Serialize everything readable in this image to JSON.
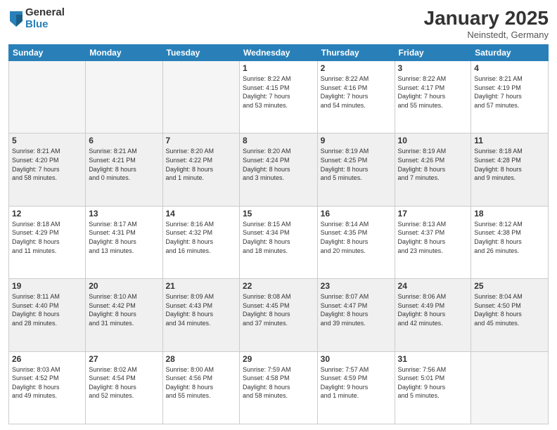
{
  "header": {
    "logo_general": "General",
    "logo_blue": "Blue",
    "month_title": "January 2025",
    "location": "Neinstedt, Germany"
  },
  "days_of_week": [
    "Sunday",
    "Monday",
    "Tuesday",
    "Wednesday",
    "Thursday",
    "Friday",
    "Saturday"
  ],
  "weeks": [
    {
      "shaded": false,
      "days": [
        {
          "num": "",
          "info": ""
        },
        {
          "num": "",
          "info": ""
        },
        {
          "num": "",
          "info": ""
        },
        {
          "num": "1",
          "info": "Sunrise: 8:22 AM\nSunset: 4:15 PM\nDaylight: 7 hours\nand 53 minutes."
        },
        {
          "num": "2",
          "info": "Sunrise: 8:22 AM\nSunset: 4:16 PM\nDaylight: 7 hours\nand 54 minutes."
        },
        {
          "num": "3",
          "info": "Sunrise: 8:22 AM\nSunset: 4:17 PM\nDaylight: 7 hours\nand 55 minutes."
        },
        {
          "num": "4",
          "info": "Sunrise: 8:21 AM\nSunset: 4:19 PM\nDaylight: 7 hours\nand 57 minutes."
        }
      ]
    },
    {
      "shaded": true,
      "days": [
        {
          "num": "5",
          "info": "Sunrise: 8:21 AM\nSunset: 4:20 PM\nDaylight: 7 hours\nand 58 minutes."
        },
        {
          "num": "6",
          "info": "Sunrise: 8:21 AM\nSunset: 4:21 PM\nDaylight: 8 hours\nand 0 minutes."
        },
        {
          "num": "7",
          "info": "Sunrise: 8:20 AM\nSunset: 4:22 PM\nDaylight: 8 hours\nand 1 minute."
        },
        {
          "num": "8",
          "info": "Sunrise: 8:20 AM\nSunset: 4:24 PM\nDaylight: 8 hours\nand 3 minutes."
        },
        {
          "num": "9",
          "info": "Sunrise: 8:19 AM\nSunset: 4:25 PM\nDaylight: 8 hours\nand 5 minutes."
        },
        {
          "num": "10",
          "info": "Sunrise: 8:19 AM\nSunset: 4:26 PM\nDaylight: 8 hours\nand 7 minutes."
        },
        {
          "num": "11",
          "info": "Sunrise: 8:18 AM\nSunset: 4:28 PM\nDaylight: 8 hours\nand 9 minutes."
        }
      ]
    },
    {
      "shaded": false,
      "days": [
        {
          "num": "12",
          "info": "Sunrise: 8:18 AM\nSunset: 4:29 PM\nDaylight: 8 hours\nand 11 minutes."
        },
        {
          "num": "13",
          "info": "Sunrise: 8:17 AM\nSunset: 4:31 PM\nDaylight: 8 hours\nand 13 minutes."
        },
        {
          "num": "14",
          "info": "Sunrise: 8:16 AM\nSunset: 4:32 PM\nDaylight: 8 hours\nand 16 minutes."
        },
        {
          "num": "15",
          "info": "Sunrise: 8:15 AM\nSunset: 4:34 PM\nDaylight: 8 hours\nand 18 minutes."
        },
        {
          "num": "16",
          "info": "Sunrise: 8:14 AM\nSunset: 4:35 PM\nDaylight: 8 hours\nand 20 minutes."
        },
        {
          "num": "17",
          "info": "Sunrise: 8:13 AM\nSunset: 4:37 PM\nDaylight: 8 hours\nand 23 minutes."
        },
        {
          "num": "18",
          "info": "Sunrise: 8:12 AM\nSunset: 4:38 PM\nDaylight: 8 hours\nand 26 minutes."
        }
      ]
    },
    {
      "shaded": true,
      "days": [
        {
          "num": "19",
          "info": "Sunrise: 8:11 AM\nSunset: 4:40 PM\nDaylight: 8 hours\nand 28 minutes."
        },
        {
          "num": "20",
          "info": "Sunrise: 8:10 AM\nSunset: 4:42 PM\nDaylight: 8 hours\nand 31 minutes."
        },
        {
          "num": "21",
          "info": "Sunrise: 8:09 AM\nSunset: 4:43 PM\nDaylight: 8 hours\nand 34 minutes."
        },
        {
          "num": "22",
          "info": "Sunrise: 8:08 AM\nSunset: 4:45 PM\nDaylight: 8 hours\nand 37 minutes."
        },
        {
          "num": "23",
          "info": "Sunrise: 8:07 AM\nSunset: 4:47 PM\nDaylight: 8 hours\nand 39 minutes."
        },
        {
          "num": "24",
          "info": "Sunrise: 8:06 AM\nSunset: 4:49 PM\nDaylight: 8 hours\nand 42 minutes."
        },
        {
          "num": "25",
          "info": "Sunrise: 8:04 AM\nSunset: 4:50 PM\nDaylight: 8 hours\nand 45 minutes."
        }
      ]
    },
    {
      "shaded": false,
      "days": [
        {
          "num": "26",
          "info": "Sunrise: 8:03 AM\nSunset: 4:52 PM\nDaylight: 8 hours\nand 49 minutes."
        },
        {
          "num": "27",
          "info": "Sunrise: 8:02 AM\nSunset: 4:54 PM\nDaylight: 8 hours\nand 52 minutes."
        },
        {
          "num": "28",
          "info": "Sunrise: 8:00 AM\nSunset: 4:56 PM\nDaylight: 8 hours\nand 55 minutes."
        },
        {
          "num": "29",
          "info": "Sunrise: 7:59 AM\nSunset: 4:58 PM\nDaylight: 8 hours\nand 58 minutes."
        },
        {
          "num": "30",
          "info": "Sunrise: 7:57 AM\nSunset: 4:59 PM\nDaylight: 9 hours\nand 1 minute."
        },
        {
          "num": "31",
          "info": "Sunrise: 7:56 AM\nSunset: 5:01 PM\nDaylight: 9 hours\nand 5 minutes."
        },
        {
          "num": "",
          "info": ""
        }
      ]
    }
  ]
}
